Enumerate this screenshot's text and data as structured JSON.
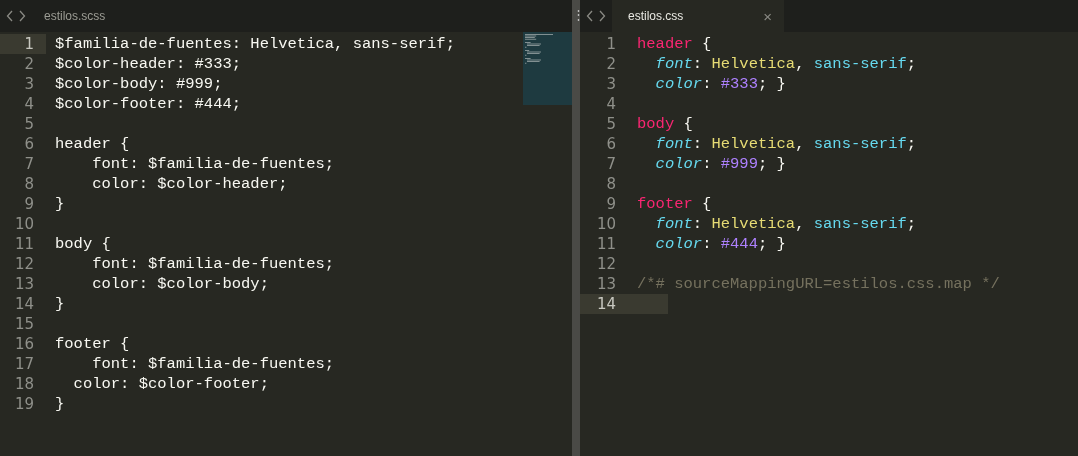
{
  "menu": "⋮",
  "panes": [
    {
      "tab": {
        "title": "estilos.scss",
        "selected": false
      },
      "minimap": true,
      "lines": [
        {
          "number": "1",
          "current": true,
          "tokens": [
            {
              "text": "$familia-de-fuentes: Helvetica, sans-serif;",
              "kind": "plain"
            }
          ]
        },
        {
          "number": "2",
          "current": false,
          "tokens": [
            {
              "text": "$color-header: #333;",
              "kind": "plain"
            }
          ]
        },
        {
          "number": "3",
          "current": false,
          "tokens": [
            {
              "text": "$color-body: #999;",
              "kind": "plain"
            }
          ]
        },
        {
          "number": "4",
          "current": false,
          "tokens": [
            {
              "text": "$color-footer: #444;",
              "kind": "plain"
            }
          ]
        },
        {
          "number": "5",
          "current": false
        },
        {
          "number": "6",
          "current": false,
          "tokens": [
            {
              "text": "header {",
              "kind": "plain"
            }
          ]
        },
        {
          "number": "7",
          "current": false,
          "tokens": [
            {
              "text": "    font: $familia-de-fuentes;",
              "kind": "plain"
            }
          ]
        },
        {
          "number": "8",
          "current": false,
          "tokens": [
            {
              "text": "    color: $color-header;",
              "kind": "plain"
            }
          ]
        },
        {
          "number": "9",
          "current": false,
          "tokens": [
            {
              "text": "}",
              "kind": "plain"
            }
          ]
        },
        {
          "number": "10",
          "current": false
        },
        {
          "number": "11",
          "current": false,
          "tokens": [
            {
              "text": "body {",
              "kind": "plain"
            }
          ]
        },
        {
          "number": "12",
          "current": false,
          "tokens": [
            {
              "text": "    font: $familia-de-fuentes;",
              "kind": "plain"
            }
          ]
        },
        {
          "number": "13",
          "current": false,
          "tokens": [
            {
              "text": "    color: $color-body;",
              "kind": "plain"
            }
          ]
        },
        {
          "number": "14",
          "current": false,
          "tokens": [
            {
              "text": "}",
              "kind": "plain"
            }
          ]
        },
        {
          "number": "15",
          "current": false
        },
        {
          "number": "16",
          "current": false,
          "tokens": [
            {
              "text": "footer {",
              "kind": "plain"
            }
          ]
        },
        {
          "number": "17",
          "current": false,
          "tokens": [
            {
              "text": "    font: $familia-de-fuentes;",
              "kind": "plain"
            }
          ]
        },
        {
          "number": "18",
          "current": false,
          "tokens": [
            {
              "text": "  color: $color-footer;",
              "kind": "plain"
            }
          ]
        },
        {
          "number": "19",
          "current": false,
          "tokens": [
            {
              "text": "}",
              "kind": "plain"
            }
          ]
        }
      ]
    },
    {
      "tab": {
        "title": "estilos.css",
        "selected": true,
        "close": "×"
      },
      "minimap": false,
      "lines": [
        {
          "number": "1",
          "current": false,
          "tokens": [
            {
              "text": "header",
              "kind": "selector"
            },
            {
              "text": " {",
              "kind": "plain"
            }
          ]
        },
        {
          "number": "2",
          "current": false,
          "tokens": [
            {
              "text": "  font",
              "kind": "property"
            },
            {
              "text": ": ",
              "kind": "plain"
            },
            {
              "text": "Helvetica",
              "kind": "value"
            },
            {
              "text": ", ",
              "kind": "plain"
            },
            {
              "text": "sans-serif",
              "kind": "keyword"
            },
            {
              "text": ";",
              "kind": "plain"
            }
          ]
        },
        {
          "number": "3",
          "current": false,
          "tokens": [
            {
              "text": "  color",
              "kind": "property"
            },
            {
              "text": ": ",
              "kind": "plain"
            },
            {
              "text": "#333",
              "kind": "number"
            },
            {
              "text": "; }",
              "kind": "plain"
            }
          ]
        },
        {
          "number": "4",
          "current": false
        },
        {
          "number": "5",
          "current": false,
          "tokens": [
            {
              "text": "body",
              "kind": "selector"
            },
            {
              "text": " {",
              "kind": "plain"
            }
          ]
        },
        {
          "number": "6",
          "current": false,
          "tokens": [
            {
              "text": "  font",
              "kind": "property"
            },
            {
              "text": ": ",
              "kind": "plain"
            },
            {
              "text": "Helvetica",
              "kind": "value"
            },
            {
              "text": ", ",
              "kind": "plain"
            },
            {
              "text": "sans-serif",
              "kind": "keyword"
            },
            {
              "text": ";",
              "kind": "plain"
            }
          ]
        },
        {
          "number": "7",
          "current": false,
          "tokens": [
            {
              "text": "  color",
              "kind": "property"
            },
            {
              "text": ": ",
              "kind": "plain"
            },
            {
              "text": "#999",
              "kind": "number"
            },
            {
              "text": "; }",
              "kind": "plain"
            }
          ]
        },
        {
          "number": "8",
          "current": false
        },
        {
          "number": "9",
          "current": false,
          "tokens": [
            {
              "text": "footer",
              "kind": "selector"
            },
            {
              "text": " {",
              "kind": "plain"
            }
          ]
        },
        {
          "number": "10",
          "current": false,
          "tokens": [
            {
              "text": "  font",
              "kind": "property"
            },
            {
              "text": ": ",
              "kind": "plain"
            },
            {
              "text": "Helvetica",
              "kind": "value"
            },
            {
              "text": ", ",
              "kind": "plain"
            },
            {
              "text": "sans-serif",
              "kind": "keyword"
            },
            {
              "text": ";",
              "kind": "plain"
            }
          ]
        },
        {
          "number": "11",
          "current": false,
          "tokens": [
            {
              "text": "  color",
              "kind": "property"
            },
            {
              "text": ": ",
              "kind": "plain"
            },
            {
              "text": "#444",
              "kind": "number"
            },
            {
              "text": "; }",
              "kind": "plain"
            }
          ]
        },
        {
          "number": "12",
          "current": false
        },
        {
          "number": "13",
          "current": false,
          "tokens": [
            {
              "text": "/*# sourceMappingURL=estilos.css.map */",
              "kind": "comment"
            }
          ]
        },
        {
          "number": "14",
          "current": true
        }
      ]
    }
  ]
}
